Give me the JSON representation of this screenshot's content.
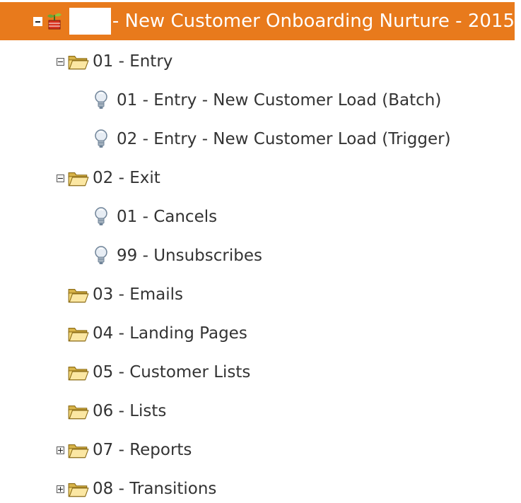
{
  "tree": {
    "root": {
      "label": "- New Customer Onboarding Nurture - 2015",
      "expanded": true,
      "icon": "program-icon"
    },
    "items": [
      {
        "label": "01 - Entry",
        "type": "folder",
        "toggle": "collapse",
        "level": 1
      },
      {
        "label": "01 - Entry - New Customer Load (Batch)",
        "type": "campaign",
        "level": 2
      },
      {
        "label": "02 - Entry - New Customer Load (Trigger)",
        "type": "campaign",
        "level": 2
      },
      {
        "label": "02 - Exit",
        "type": "folder",
        "toggle": "collapse",
        "level": 1
      },
      {
        "label": "01 - Cancels",
        "type": "campaign",
        "level": 2
      },
      {
        "label": "99 - Unsubscribes",
        "type": "campaign",
        "level": 2
      },
      {
        "label": "03 - Emails",
        "type": "folder",
        "toggle": "none",
        "level": 1
      },
      {
        "label": "04 - Landing Pages",
        "type": "folder",
        "toggle": "none",
        "level": 1
      },
      {
        "label": "05 - Customer Lists",
        "type": "folder",
        "toggle": "none",
        "level": 1
      },
      {
        "label": "06 - Lists",
        "type": "folder",
        "toggle": "none",
        "level": 1
      },
      {
        "label": "07 - Reports",
        "type": "folder",
        "toggle": "expand",
        "level": 1
      },
      {
        "label": "08 - Transitions",
        "type": "folder",
        "toggle": "expand",
        "level": 1
      }
    ]
  },
  "colors": {
    "selected_bg": "#e87a1c",
    "selected_text": "#ffffff",
    "text": "#333333"
  }
}
